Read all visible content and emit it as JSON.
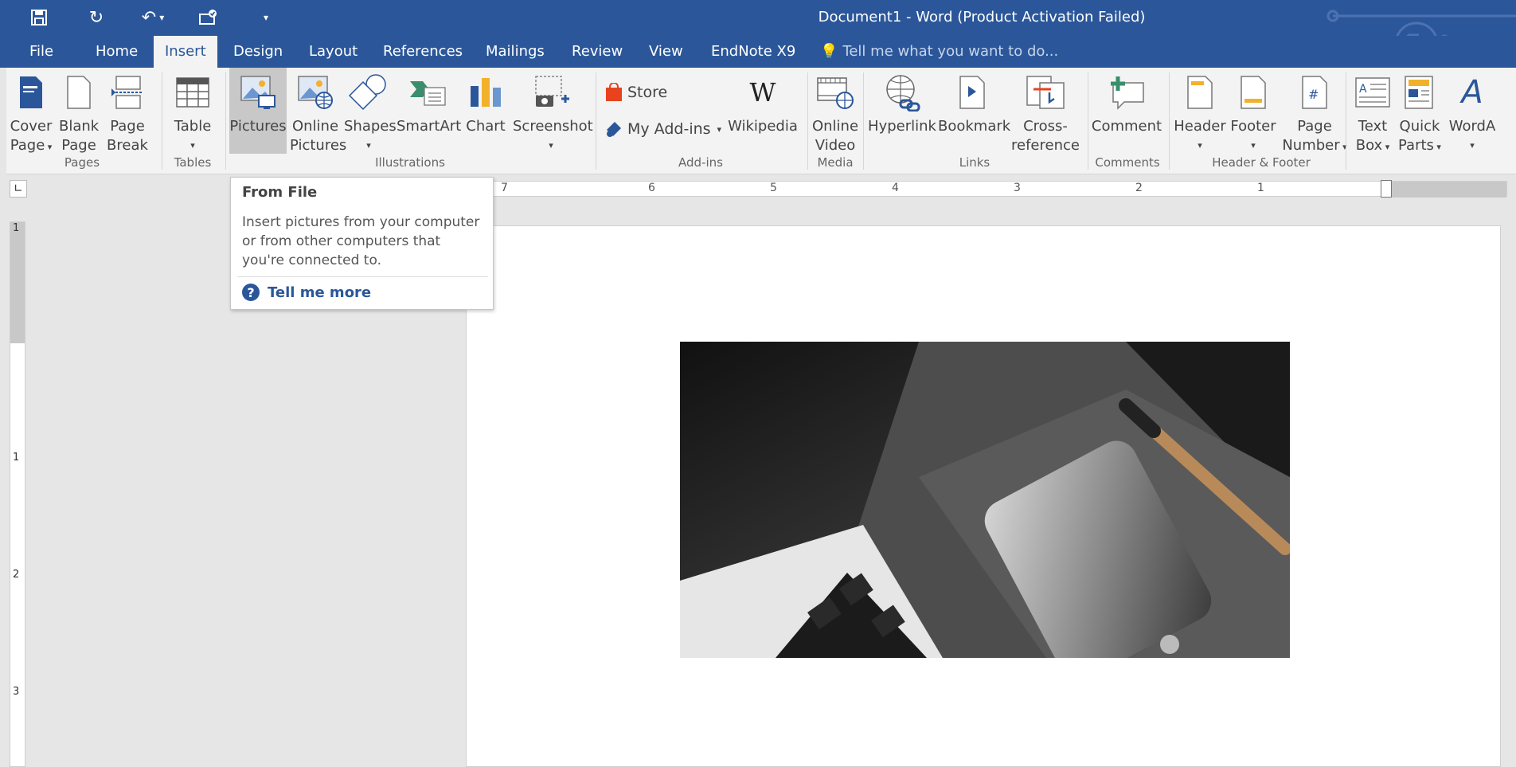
{
  "window": {
    "title": "Document1 - Word (Product Activation Failed)"
  },
  "tabs": [
    {
      "label": "File"
    },
    {
      "label": "Home"
    },
    {
      "label": "Insert"
    },
    {
      "label": "Design"
    },
    {
      "label": "Layout"
    },
    {
      "label": "References"
    },
    {
      "label": "Mailings"
    },
    {
      "label": "Review"
    },
    {
      "label": "View"
    },
    {
      "label": "EndNote X9"
    }
  ],
  "tellme": {
    "placeholder": "Tell me what you want to do..."
  },
  "ribbon": {
    "pages": {
      "cover": [
        "Cover",
        "Page"
      ],
      "blank": [
        "Blank",
        "Page"
      ],
      "break": [
        "Page",
        "Break"
      ],
      "group": "Pages"
    },
    "tables": {
      "table": "Table",
      "group": "Tables"
    },
    "illustrations": {
      "pictures": "Pictures",
      "online_pictures": [
        "Online",
        "Pictures"
      ],
      "shapes": "Shapes",
      "smartart": "SmartArt",
      "chart": "Chart",
      "screenshot": "Screenshot",
      "group": "Illustrations"
    },
    "addins": {
      "store": "Store",
      "my_addins": "My Add-ins",
      "wikipedia": "Wikipedia",
      "group": "Add-ins"
    },
    "media": {
      "online_video": [
        "Online",
        "Video"
      ],
      "group": "Media"
    },
    "links": {
      "hyperlink": "Hyperlink",
      "bookmark": "Bookmark",
      "crossref": [
        "Cross-",
        "reference"
      ],
      "group": "Links"
    },
    "comments": {
      "comment": "Comment",
      "group": "Comments"
    },
    "header_footer": {
      "header": "Header",
      "footer": "Footer",
      "page_number": [
        "Page",
        "Number"
      ],
      "group": "Header & Footer"
    },
    "text": {
      "text_box": [
        "Text",
        "Box"
      ],
      "quick_parts": [
        "Quick",
        "Parts"
      ],
      "wordart": "WordA"
    }
  },
  "ruler": {
    "numbers": [
      "7",
      "6",
      "5",
      "4",
      "3",
      "2",
      "1"
    ],
    "vnumbers": [
      "1",
      "1",
      "2",
      "3"
    ]
  },
  "tooltip": {
    "title": "From File",
    "description": "Insert pictures from your computer or from other computers that you're connected to.",
    "link": "Tell me more"
  },
  "colors": {
    "brand": "#2b579a",
    "ribbon_bg": "#f3f3f3",
    "workspace": "#e6e6e6"
  }
}
